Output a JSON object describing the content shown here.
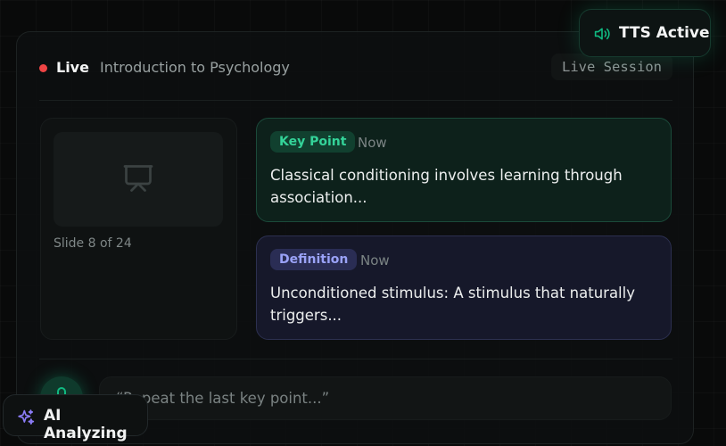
{
  "header": {
    "live_label": "Live",
    "course_title": "Introduction to Psychology",
    "session_label": "Live Session"
  },
  "slide": {
    "icon": "presentation-icon",
    "counter": "Slide 8 of 24"
  },
  "notes": [
    {
      "tag": "Key Point",
      "time": "Now",
      "text": "Classical conditioning involves learning through association..."
    },
    {
      "tag": "Definition",
      "time": "Now",
      "text": "Unconditioned stimulus: A stimulus that naturally triggers..."
    }
  ],
  "voice": {
    "icon": "microphone-icon",
    "transcript": "“Repeat the last key point...”"
  },
  "badges": {
    "tts": {
      "icon": "speaker-icon",
      "label": "TTS Active"
    },
    "ai": {
      "icon": "sparkles-icon",
      "label": "AI Analyzing"
    }
  },
  "colors": {
    "live_indicator": "#ef4444",
    "key_point_accent": "#34d399",
    "definition_accent": "#9aa2f7",
    "background": "#090a0a"
  }
}
